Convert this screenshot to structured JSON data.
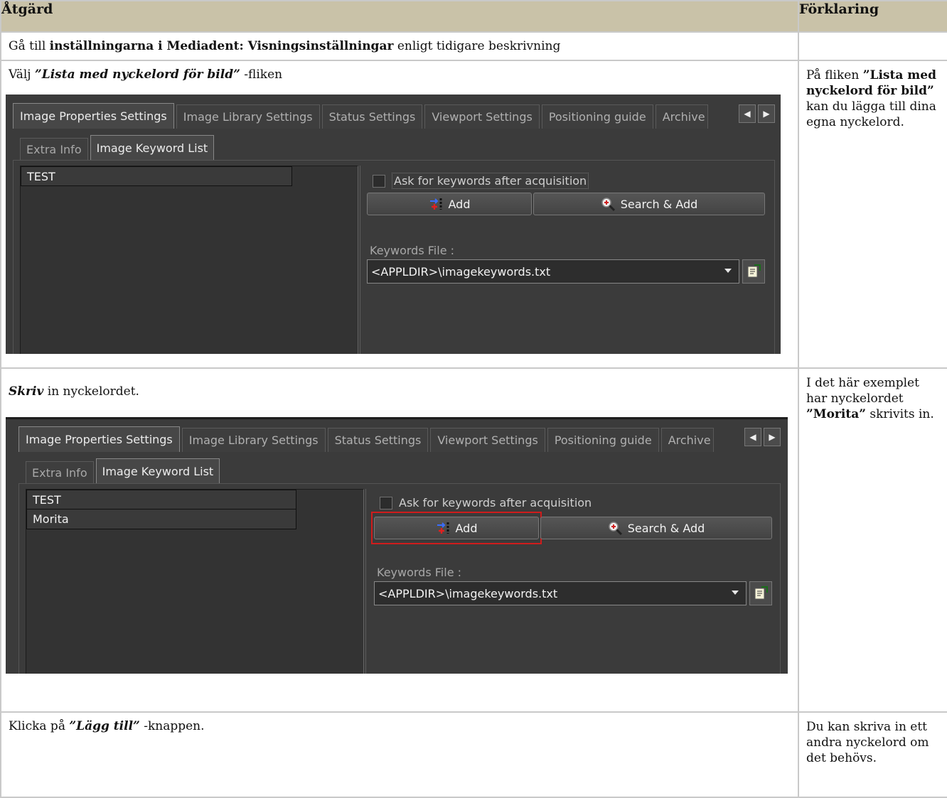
{
  "header": {
    "col_action": "Åtgärd",
    "col_explanation": "Förklaring"
  },
  "rows": [
    {
      "action": {
        "pre": "Gå till ",
        "bold": "inställningarna i Mediadent: Visningsinställningar",
        "post": " enligt tidigare beskrivning"
      },
      "explanation": ""
    },
    {
      "action": {
        "pre": "Välj ",
        "bold": "”Lista med nyckelord för bild”",
        "post": " -fliken"
      },
      "explanation": {
        "pre": "På fliken ",
        "bold": "”Lista med nyckelord för bild”",
        "post": " kan du lägga till dina egna nyckelord."
      }
    },
    {
      "action": {
        "bold": "Skriv",
        "post": " in nyckelordet."
      },
      "explanation": {
        "pre": "I det här exemplet har nyckelordet ",
        "bold": "”Morita”",
        "post": " skrivits in."
      }
    },
    {
      "action": {
        "pre": "Klicka på ",
        "bold": "”Lägg till”",
        "post": " -knappen."
      },
      "explanation": {
        "pre": "Du kan skriva in ett andra nyckelord om det behövs."
      }
    }
  ],
  "app": {
    "tabs": [
      "Image Properties Settings",
      "Image Library Settings",
      "Status Settings",
      "Viewport Settings",
      "Positioning guide",
      "Archive"
    ],
    "subtabs": [
      "Extra Info",
      "Image Keyword List"
    ],
    "ask_checkbox_label": "Ask for keywords after acquisition",
    "add_button": "Add",
    "search_add_button": "Search & Add",
    "keywords_file_label": "Keywords File :",
    "keywords_file_value": "<APPLDIR>\\imagekeywords.txt",
    "keywords_shot1": [
      "TEST"
    ],
    "keywords_shot2": [
      "TEST",
      "Morita"
    ]
  },
  "colors": {
    "header_bg": "#c9c2a8",
    "app_bg": "#3b3b3b",
    "highlight": "#d01c1c"
  },
  "icons": [
    "scroll-left-icon",
    "scroll-right-icon",
    "add-arrows-icon",
    "magnifier-icon",
    "dropdown-arrow-icon",
    "browse-file-icon"
  ]
}
